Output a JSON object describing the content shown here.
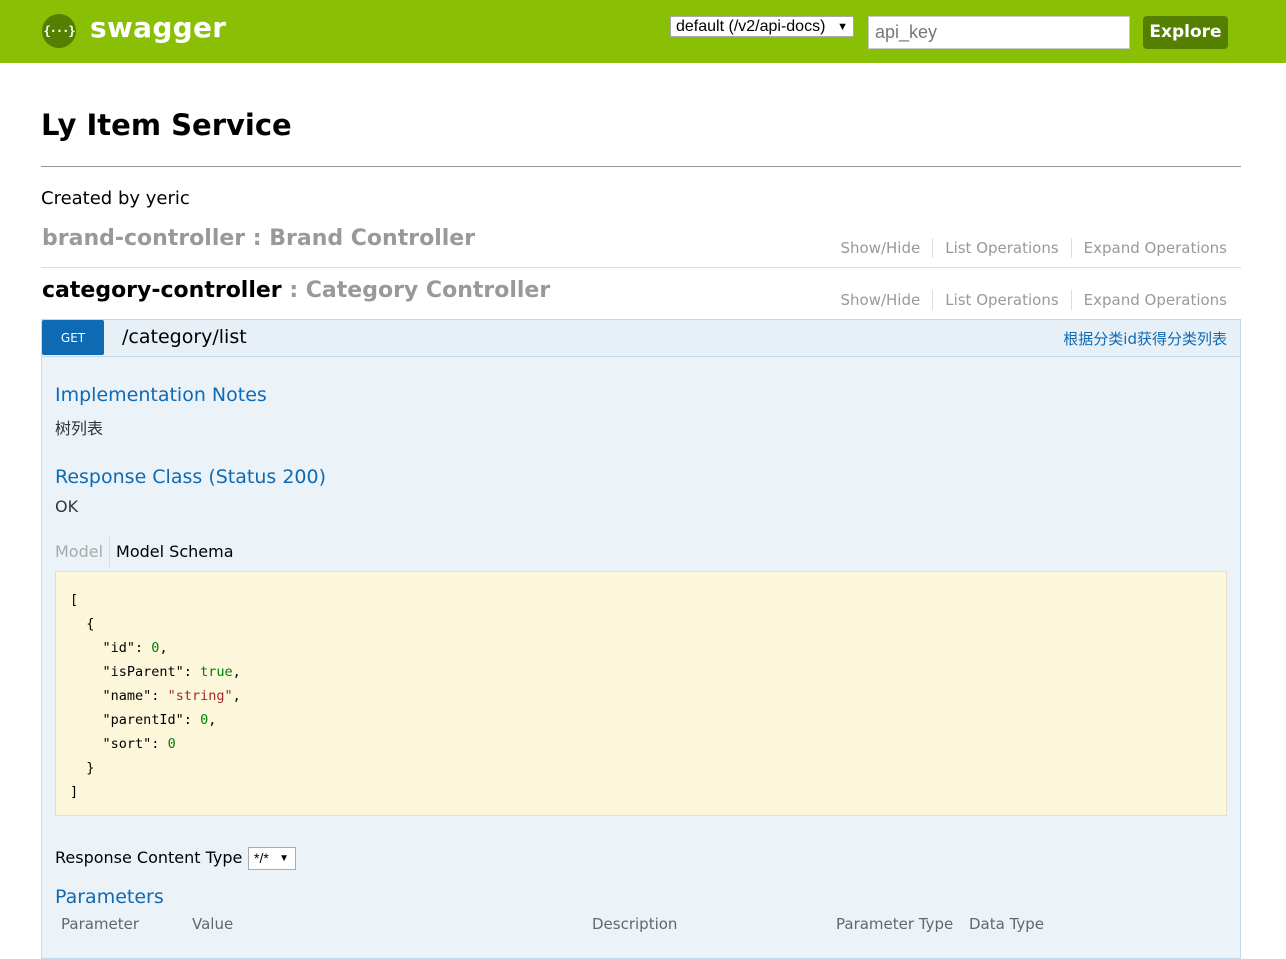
{
  "header": {
    "logo_icon_glyph": "{···}",
    "logo_text": "swagger",
    "spec_select": "default (/v2/api-docs)",
    "api_key_placeholder": "api_key",
    "explore_label": "Explore"
  },
  "info": {
    "title": "Ly Item Service",
    "created_by": "Created by yeric"
  },
  "resources": [
    {
      "name": "brand-controller",
      "description": " : Brand Controller",
      "links": [
        "Show/Hide",
        "List Operations",
        "Expand Operations"
      ]
    },
    {
      "name": "category-controller",
      "description": " : Category Controller",
      "links": [
        "Show/Hide",
        "List Operations",
        "Expand Operations"
      ]
    }
  ],
  "operation": {
    "method": "GET",
    "path": "/category/list",
    "summary": "根据分类id获得分类列表",
    "implementation_notes_title": "Implementation Notes",
    "implementation_notes": "树列表",
    "response_class_title": "Response Class (Status 200)",
    "response_class_text": "OK",
    "model_tabs": [
      "Model",
      "Model Schema"
    ],
    "schema": {
      "open_bracket": "[",
      "open_brace": "{",
      "fields": [
        {
          "key": "\"id\"",
          "value": "0",
          "kind": "num",
          "comma": ","
        },
        {
          "key": "\"isParent\"",
          "value": "true",
          "kind": "bool",
          "comma": ","
        },
        {
          "key": "\"name\"",
          "value": "\"string\"",
          "kind": "str",
          "comma": ","
        },
        {
          "key": "\"parentId\"",
          "value": "0",
          "kind": "num",
          "comma": ","
        },
        {
          "key": "\"sort\"",
          "value": "0",
          "kind": "num",
          "comma": ""
        }
      ],
      "close_brace": "}",
      "close_bracket": "]"
    },
    "response_content_type_label": "Response Content Type",
    "response_content_type_value": "*/*",
    "parameters_title": "Parameters",
    "parameter_columns": [
      "Parameter",
      "Value",
      "Description",
      "Parameter Type",
      "Data Type"
    ]
  },
  "colors": {
    "header_bg": "#89bf04",
    "explore_bg": "#547f00",
    "get_method": "#0f6ab4",
    "op_bg": "#ebf3f9",
    "schema_bg": "#fcf6db"
  }
}
